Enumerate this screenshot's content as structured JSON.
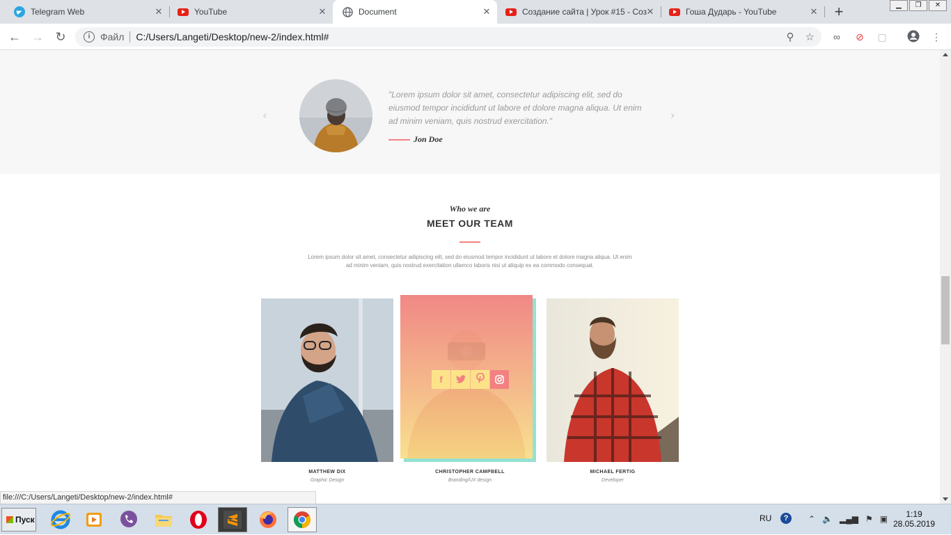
{
  "browser": {
    "tabs": [
      {
        "title": "Telegram Web",
        "icon": "telegram-icon"
      },
      {
        "title": "YouTube",
        "icon": "youtube-icon"
      },
      {
        "title": "Document",
        "icon": "globe-icon",
        "active": true
      },
      {
        "title": "Создание сайта | Урок #15 - Соз",
        "icon": "youtube-icon"
      },
      {
        "title": "Гоша Дударь - YouTube",
        "icon": "youtube-icon"
      }
    ],
    "omnibox": {
      "scheme_label": "Файл",
      "url": "C:/Users/Langeti/Desktop/new-2/index.html#"
    },
    "status_url": "file:///C:/Users/Langeti/Desktop/new-2/index.html#"
  },
  "page": {
    "testimonial": {
      "quote": "\"Lorem ipsum dolor sit amet, consectetur adipiscing elit, sed do eiusmod tempor incididunt ut labore et dolore magna aliqua. Ut enim ad minim veniam, quis nostrud exercitation.\"",
      "author": "Jon Doe",
      "prev_arrow": "‹",
      "next_arrow": "›"
    },
    "team": {
      "kicker": "Who we are",
      "title": "MEET OUR TEAM",
      "lead": "Lorem ipsum dolor sit amet, consectetur adipiscing elit, sed do eiusmod tempor incididunt ut labore et dolore magna aliqua. Ut enim ad minim veniam, quis nostrud exercitation ullamco laboris nisi ut aliquip ex ea commodo consequat.",
      "members": [
        {
          "name": "MATTHEW DIX",
          "role": "Graphic Design"
        },
        {
          "name": "CHRISTOPHER CAMPBELL",
          "role": "Branding/UX design"
        },
        {
          "name": "MICHAEL FERTIG",
          "role": "Developer"
        }
      ],
      "socials": [
        "f",
        "t",
        "p",
        "ig"
      ]
    },
    "colors": {
      "accent_red": "#f38181",
      "accent_yellow": "#fce38a",
      "accent_teal": "#95e1d3"
    }
  },
  "taskbar": {
    "start_label": "Пуск",
    "language": "RU",
    "time": "1:19",
    "date": "28.05.2019"
  }
}
